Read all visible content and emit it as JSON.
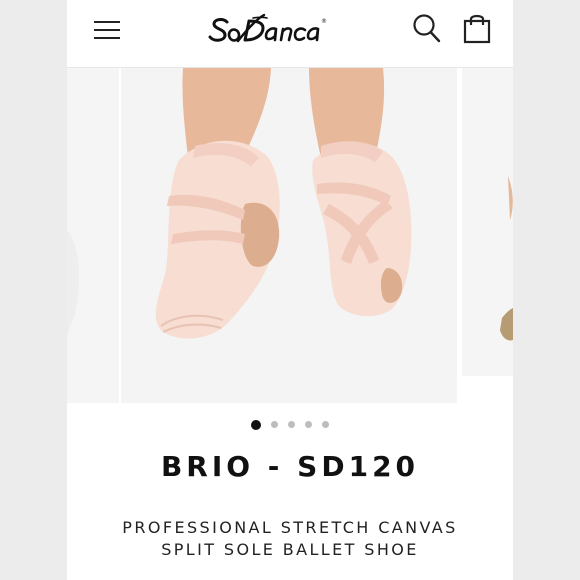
{
  "header": {
    "logo_text": "So Danca",
    "menu_icon": "hamburger-menu-icon",
    "search_icon": "search-icon",
    "cart_icon": "shopping-bag-icon"
  },
  "gallery": {
    "total_images": 5,
    "active_index": 0,
    "zoom_icon": "zoom-icon",
    "image_alt": "Pink stretch canvas split sole ballet shoes worn on feet"
  },
  "product": {
    "title": "BRIO - SD120",
    "subtitle_line1": "PROFESSIONAL STRETCH CANVAS",
    "subtitle_line2": "SPLIT SOLE BALLET SHOE"
  },
  "colors": {
    "shoe": "#f7ddd2",
    "sole": "#dcae8f",
    "skin": "#e8b89a",
    "text": "#111111"
  }
}
